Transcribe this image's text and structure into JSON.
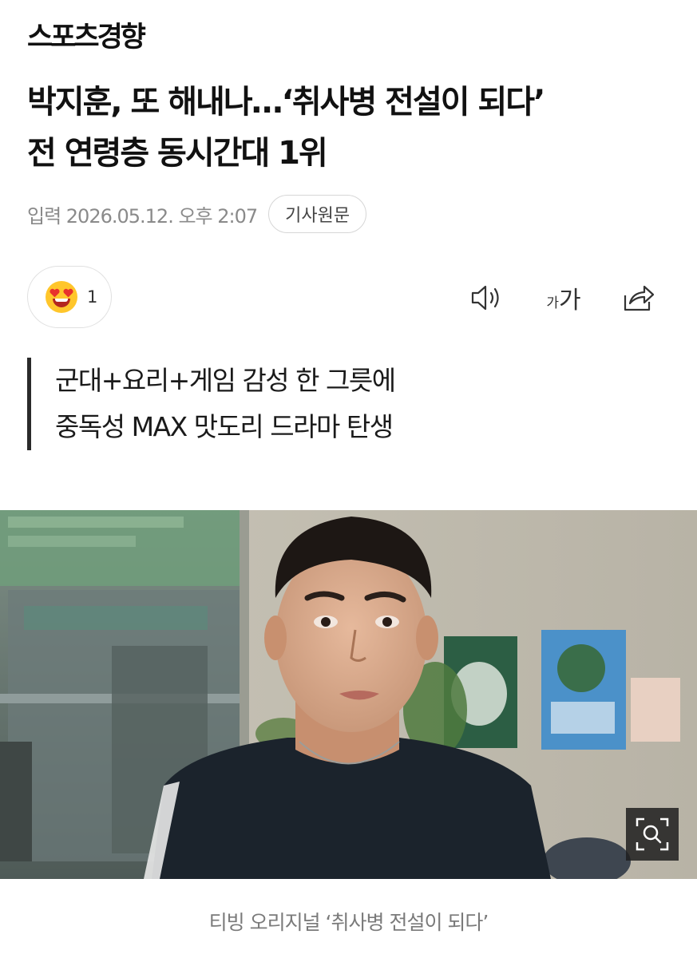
{
  "header": {
    "logo_text": "스포츠경향"
  },
  "article": {
    "title_line1": "박지훈, 또 해내나…‘취사병 전설이 되다’",
    "title_line2": "전 연령층 동시간대 1위",
    "published": "입력 2026.05.12. 오후 2:07",
    "source_button_label": "기사원문",
    "subheadline_line1": "군대+요리+게임 감성 한 그릇에",
    "subheadline_line2": "중독성 MAX 맛도리 드라마 탄생",
    "photo_caption": "티빙 오리지널 ‘취사병 전설이 되다’"
  },
  "reaction": {
    "emoji_icon": "heart-eyes-emoji-icon",
    "count": "1"
  },
  "toolbar": {
    "speaker_icon": "speaker-icon",
    "font_small_label": "가",
    "font_big_label": "가",
    "share_icon": "share-icon"
  },
  "image": {
    "zoom_icon": "zoom-search-icon"
  },
  "colors": {
    "text": "#1a1a1a",
    "meta": "#8a8a8a",
    "emoji": "#ffc62b",
    "caption": "#7a7a7a"
  }
}
